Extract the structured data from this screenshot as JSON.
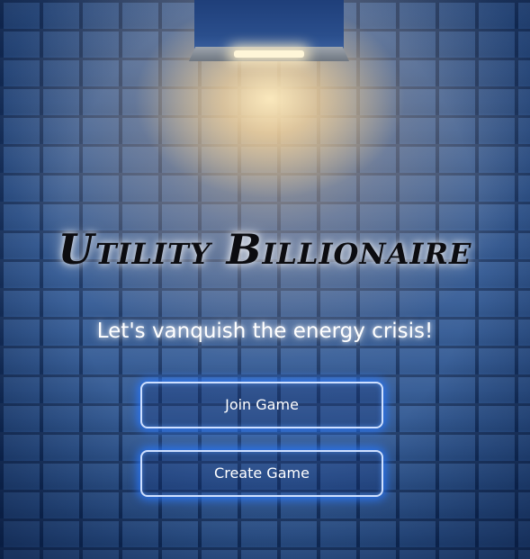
{
  "header": {
    "title": "Utility Billionaire",
    "tagline": "Let's vanquish the energy crisis!"
  },
  "menu": {
    "join_label": "Join Game",
    "create_label": "Create Game"
  },
  "decor": {
    "background": "brick-wall",
    "lamp_icon": "wall-lamp-icon",
    "accent_glow": "#2f7bff",
    "light_color": "#ffe7b8"
  }
}
